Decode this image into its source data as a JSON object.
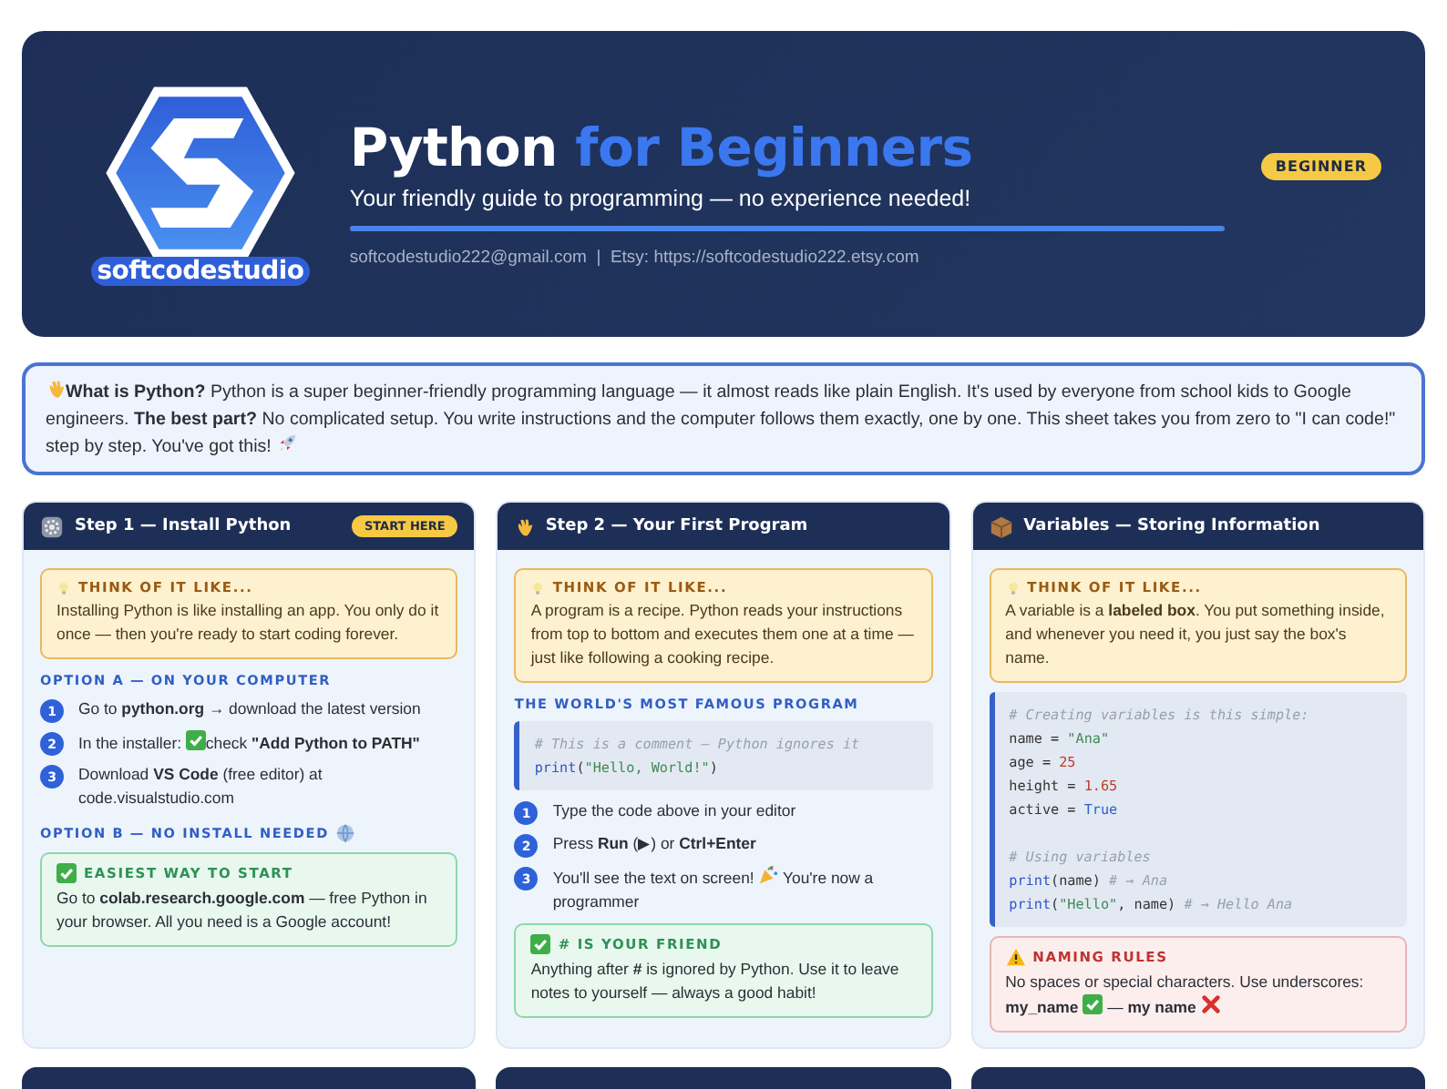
{
  "header": {
    "logo_text": "softcodestudio",
    "title_main": "Python",
    "title_accent": "for Beginners",
    "subtitle": "Your friendly guide to programming — no experience needed!",
    "contact": "softcodestudio222@gmail.com  |  Etsy: https://softcodestudio222.etsy.com",
    "badge": "BEGINNER"
  },
  "intro": {
    "parts": [
      {
        "kind": "mark"
      },
      "**What is Python?** Python is a super beginner-friendly programming language — it almost reads like plain English. It's used by everyone from school kids to Google engineers. **The best part?** No complicated setup. You write instructions and the computer follows them exactly, one by one. This sheet takes you from zero to \"I can code!\" step by step. You've got this! ",
      {
        "kind": "mark"
      }
    ]
  },
  "cards": [
    {
      "title": "Step 1 — Install Python",
      "badge": "START HERE",
      "blocks": [
        {
          "kind": "tip",
          "label": "THINK OF IT LIKE...",
          "parts": [
            "Installing Python is like installing an app. You only do it once — then you're ready to start coding forever."
          ]
        },
        {
          "kind": "heading",
          "text": "OPTION A — ON YOUR COMPUTER"
        },
        {
          "kind": "steps",
          "items": [
            {
              "number": "1",
              "parts": [
                "Go to **python.org** → download the latest version"
              ]
            },
            {
              "number": "2",
              "parts": [
                "In the installer: ",
                {
                  "kind": "mark"
                },
                "check **\"Add Python to PATH\"**"
              ]
            },
            {
              "number": "3",
              "parts": [
                "Download **VS Code** (free editor) at code.visualstudio.com"
              ]
            }
          ]
        },
        {
          "kind": "heading",
          "text": "OPTION B — NO INSTALL NEEDED"
        },
        {
          "kind": "note",
          "label": "EASIEST WAY TO START",
          "parts": [
            "Go to **colab.research.google.com** — free Python in your browser. All you need is a Google account!"
          ]
        }
      ]
    },
    {
      "title": "Step 2 — Your First Program",
      "blocks": [
        {
          "kind": "tip",
          "label": "THINK OF IT LIKE...",
          "parts": [
            "A program is a recipe. Python reads your instructions from top to bottom and executes them one at a time — just like following a cooking recipe."
          ]
        },
        {
          "kind": "heading",
          "text": "THE WORLD'S MOST FAMOUS PROGRAM"
        },
        {
          "kind": "code",
          "groups": [
            {
              "lines": [
                {
                  "tokens": [
                    {
                      "t": "# This is a comment — Python ignores it",
                      "kind": "comment"
                    }
                  ]
                },
                {
                  "tokens": [
                    {
                      "t": "print",
                      "kind": "func"
                    },
                    {
                      "t": "(",
                      "kind": "plain"
                    },
                    {
                      "t": "\"Hello, World!\"",
                      "kind": "string"
                    },
                    {
                      "t": ")",
                      "kind": "plain"
                    }
                  ]
                }
              ]
            }
          ]
        },
        {
          "kind": "steps",
          "items": [
            {
              "number": "1",
              "parts": [
                "Type the code above in your editor"
              ]
            },
            {
              "number": "2",
              "parts": [
                "Press **Run** (▶) or **Ctrl+Enter**"
              ]
            },
            {
              "number": "3",
              "parts": [
                "You'll see the text on screen! ",
                {
                  "kind": "mark"
                },
                " You're now a programmer"
              ]
            }
          ]
        },
        {
          "kind": "note",
          "label": "# IS YOUR FRIEND",
          "parts": [
            "Anything after **#** is ignored by Python. Use it to leave notes to yourself — always a good habit!"
          ]
        }
      ]
    },
    {
      "title": "Variables — Storing Information",
      "blocks": [
        {
          "kind": "tip",
          "label": "THINK OF IT LIKE...",
          "parts": [
            "A variable is a **labeled box**. You put something inside, and whenever you need it, you just say the box's name."
          ]
        },
        {
          "kind": "code",
          "groups": [
            {
              "lines": [
                {
                  "tokens": [
                    {
                      "t": "# Creating variables is this simple:",
                      "kind": "comment"
                    }
                  ]
                },
                {
                  "tokens": [
                    {
                      "t": "name = ",
                      "kind": "plain"
                    },
                    {
                      "t": "\"Ana\"",
                      "kind": "string"
                    }
                  ]
                },
                {
                  "tokens": [
                    {
                      "t": "age = ",
                      "kind": "plain"
                    },
                    {
                      "t": "25",
                      "kind": "number"
                    }
                  ]
                },
                {
                  "tokens": [
                    {
                      "t": "height = ",
                      "kind": "plain"
                    },
                    {
                      "t": "1.65",
                      "kind": "number"
                    }
                  ]
                },
                {
                  "tokens": [
                    {
                      "t": "active = ",
                      "kind": "plain"
                    },
                    {
                      "t": "True",
                      "kind": "bool"
                    }
                  ]
                }
              ]
            },
            {
              "lines": [
                {
                  "tokens": [
                    {
                      "t": "# Using variables",
                      "kind": "comment"
                    }
                  ]
                },
                {
                  "tokens": [
                    {
                      "t": "print",
                      "kind": "func"
                    },
                    {
                      "t": "(name) ",
                      "kind": "plain"
                    },
                    {
                      "t": "# → Ana",
                      "kind": "comment"
                    }
                  ]
                },
                {
                  "tokens": [
                    {
                      "t": "print",
                      "kind": "func"
                    },
                    {
                      "t": "(",
                      "kind": "plain"
                    },
                    {
                      "t": "\"Hello\"",
                      "kind": "string"
                    },
                    {
                      "t": ", name) ",
                      "kind": "plain"
                    },
                    {
                      "t": "# → Hello Ana",
                      "kind": "comment"
                    }
                  ]
                }
              ]
            }
          ]
        },
        {
          "kind": "warning",
          "label": "NAMING RULES",
          "parts": [
            "No spaces or special characters. Use underscores: **my_name** ",
            {
              "kind": "mark"
            },
            " — **my name** ",
            {
              "kind": "mark"
            }
          ]
        }
      ]
    }
  ]
}
